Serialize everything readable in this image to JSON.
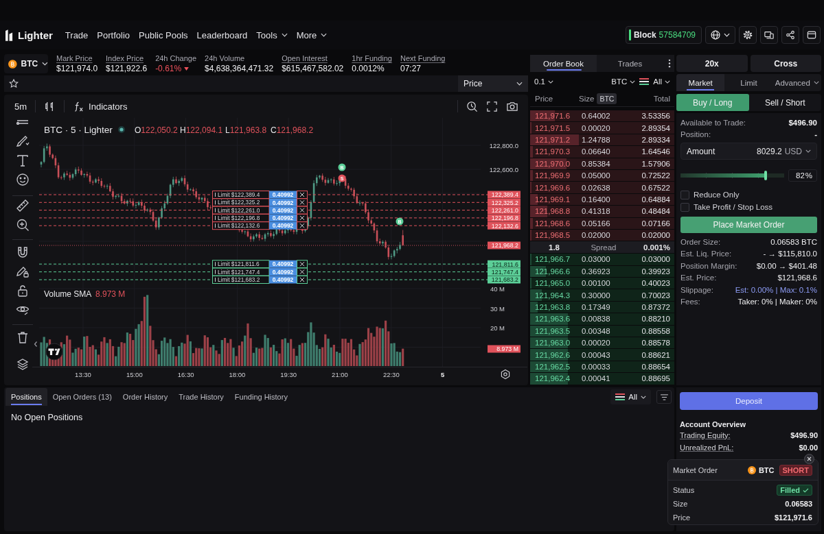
{
  "header": {
    "logo": "Lighter",
    "nav": [
      {
        "label": "Trade",
        "dropdown": false
      },
      {
        "label": "Portfolio",
        "dropdown": false
      },
      {
        "label": "Public Pools",
        "dropdown": false
      },
      {
        "label": "Leaderboard",
        "dropdown": false
      },
      {
        "label": "Tools",
        "dropdown": true
      },
      {
        "label": "More",
        "dropdown": true
      }
    ],
    "block": {
      "label": "Block",
      "value": "57584709"
    }
  },
  "ticker": {
    "symbol": "BTC",
    "stats": [
      {
        "label": "Mark Price",
        "value": "$121,974.0",
        "underlined": true,
        "negative": false
      },
      {
        "label": "Index Price",
        "value": "$121,922.6",
        "underlined": true,
        "negative": false
      },
      {
        "label": "24h Change",
        "value": "-0.61%",
        "underlined": false,
        "negative": true
      },
      {
        "label": "24h Volume",
        "value": "$4,638,364,471.32",
        "underlined": false,
        "negative": false
      },
      {
        "label": "Open Interest",
        "value": "$615,467,582.02",
        "underlined": true,
        "negative": false
      },
      {
        "label": "1hr Funding",
        "value": "0.0012%",
        "underlined": true,
        "negative": false
      },
      {
        "label": "Next Funding",
        "value": "07:27",
        "underlined": true,
        "negative": false
      }
    ]
  },
  "chart": {
    "price_type": "Price",
    "interval": "5m",
    "indicators": "Indicators",
    "title": "BTC · 5 · Lighter",
    "ohlc": [
      {
        "letter": "O",
        "value": "122,050.2"
      },
      {
        "letter": "H",
        "value": "122,094.1"
      },
      {
        "letter": "L",
        "value": "121,963.8"
      },
      {
        "letter": "C",
        "value": "121,968.2"
      }
    ],
    "price_ticks": [
      "122,800.0",
      "122,600.0"
    ],
    "orders": [
      {
        "kind": "sell",
        "label": "Limit $122,389.4",
        "size": "0.40992",
        "tag": "122,389.4"
      },
      {
        "kind": "sell",
        "label": "Limit $122,325.2",
        "size": "0.40992",
        "tag": "122,325.2"
      },
      {
        "kind": "sell",
        "label": "Limit $122,261.0",
        "size": "0.40992",
        "tag": "122,261.0"
      },
      {
        "kind": "sell",
        "label": "Limit $122,196.8",
        "size": "0.40992",
        "tag": "122,196.8"
      },
      {
        "kind": "sell",
        "label": "Limit $122,132.6",
        "size": "0.40992",
        "tag": "122,132.6"
      },
      {
        "kind": "buy",
        "label": "Limit $121,811.6",
        "size": "0.40992",
        "tag": "121,811.6"
      },
      {
        "kind": "buy",
        "label": "Limit $121,747.4",
        "size": "0.40992",
        "tag": "121,747.4"
      },
      {
        "kind": "buy",
        "label": "Limit $121,683.2",
        "size": "0.40992",
        "tag": "121,683.2"
      }
    ],
    "last_price": "121,968.2",
    "markers": [
      {
        "kind": "buy",
        "letter": "B"
      },
      {
        "kind": "sell",
        "letter": "S"
      },
      {
        "kind": "buy",
        "letter": "B"
      }
    ],
    "volume_label": "Volume SMA",
    "volume_value": "8.973 M",
    "volume_ticks": [
      "40 M",
      "30 M",
      "20 M"
    ],
    "volume_tag": "8.973 M",
    "time_ticks": [
      "13:30",
      "15:00",
      "16:30",
      "18:00",
      "19:30",
      "21:00",
      "22:30"
    ],
    "time_scale_label": "5"
  },
  "order_book": {
    "tabs": [
      {
        "label": "Order Book",
        "selected": true
      },
      {
        "label": "Trades",
        "selected": false
      }
    ],
    "tick_size": "0.1",
    "unit": "BTC",
    "filter": "All",
    "columns": [
      "Price",
      "Size",
      "Total"
    ],
    "size_badge": "BTC",
    "asks": [
      {
        "price": "121,971.6",
        "size": "0.64002",
        "total": "3.53356",
        "level": 0.17
      },
      {
        "price": "121,971.5",
        "size": "0.00020",
        "total": "2.89354",
        "level": 0.01
      },
      {
        "price": "121,971.2",
        "size": "1.24788",
        "total": "2.89334",
        "level": 0.34
      },
      {
        "price": "121,970.3",
        "size": "0.06640",
        "total": "1.64546",
        "level": 0.02
      },
      {
        "price": "121,970.0",
        "size": "0.85384",
        "total": "1.57906",
        "level": 0.25
      },
      {
        "price": "121,969.9",
        "size": "0.05000",
        "total": "0.72522",
        "level": 0.02
      },
      {
        "price": "121,969.6",
        "size": "0.02638",
        "total": "0.67522",
        "level": 0.01
      },
      {
        "price": "121,969.1",
        "size": "0.16400",
        "total": "0.64884",
        "level": 0.05
      },
      {
        "price": "121,968.8",
        "size": "0.41318",
        "total": "0.48484",
        "level": 0.12
      },
      {
        "price": "121,968.6",
        "size": "0.05166",
        "total": "0.07166",
        "level": 0.02
      },
      {
        "price": "121,968.5",
        "size": "0.02000",
        "total": "0.02000",
        "level": 0.01
      }
    ],
    "spread": {
      "value": "1.8",
      "label": "Spread",
      "percent": "0.001%"
    },
    "bids": [
      {
        "price": "121,966.7",
        "size": "0.03000",
        "total": "0.03000",
        "level": 0.01
      },
      {
        "price": "121,966.6",
        "size": "0.36923",
        "total": "0.39923",
        "level": 0.11
      },
      {
        "price": "121,965.0",
        "size": "0.00100",
        "total": "0.40023",
        "level": 0.01
      },
      {
        "price": "121,964.3",
        "size": "0.30000",
        "total": "0.70023",
        "level": 0.08
      },
      {
        "price": "121,963.8",
        "size": "0.17349",
        "total": "0.87372",
        "level": 0.05
      },
      {
        "price": "121,963.6",
        "size": "0.00838",
        "total": "0.88210",
        "level": 0.26
      },
      {
        "price": "121,963.5",
        "size": "0.00348",
        "total": "0.88558",
        "level": 0.26
      },
      {
        "price": "121,963.0",
        "size": "0.00020",
        "total": "0.88578",
        "level": 0.26
      },
      {
        "price": "121,962.6",
        "size": "0.00043",
        "total": "0.88621",
        "level": 0.26
      },
      {
        "price": "121,962.5",
        "size": "0.00033",
        "total": "0.88654",
        "level": 0.26
      },
      {
        "price": "121,962.4",
        "size": "0.00041",
        "total": "0.88695",
        "level": 0.26
      }
    ]
  },
  "order_form": {
    "leverage": "20x",
    "margin_mode": "Cross",
    "type_tabs": [
      {
        "label": "Market",
        "selected": true,
        "dropdown": false
      },
      {
        "label": "Limit",
        "selected": false,
        "dropdown": false
      },
      {
        "label": "Advanced",
        "selected": false,
        "dropdown": true
      }
    ],
    "sides": [
      {
        "label": "Buy / Long",
        "selected": true,
        "kind": "buy"
      },
      {
        "label": "Sell / Short",
        "selected": false,
        "kind": "sell"
      }
    ],
    "info": [
      {
        "label": "Available to Trade:",
        "value": "$496.90"
      },
      {
        "label": "Position:",
        "value": "-"
      }
    ],
    "amount": {
      "label": "Amount",
      "value": "8029.2",
      "unit": "USD"
    },
    "slider": {
      "level": 0.82,
      "value": "82",
      "unit": "%"
    },
    "checkboxes": [
      {
        "label": "Reduce Only",
        "checked": false
      },
      {
        "label": "Take Profit / Stop Loss",
        "checked": false
      }
    ],
    "submit": "Place Market Order",
    "summary": [
      {
        "label": "Order Size:",
        "value": "0.06583 BTC",
        "accent": false
      },
      {
        "label": "Est. Liq. Price:",
        "value": "- → $115,810.0",
        "accent": false
      },
      {
        "label": "Position Margin:",
        "value": "$0.00 → $401.48",
        "accent": false
      },
      {
        "label": "Est. Price:",
        "value": "$121,968.6",
        "accent": false
      },
      {
        "label": "Slippage:",
        "value": "Est: 0.00% | Max: 0.1%",
        "accent": true
      },
      {
        "label": "Fees:",
        "value": "Taker: 0% | Maker: 0%",
        "accent": false
      }
    ]
  },
  "positions": {
    "tabs": [
      {
        "label": "Positions",
        "selected": true
      },
      {
        "label": "Open Orders (13)",
        "selected": false
      },
      {
        "label": "Order History",
        "selected": false
      },
      {
        "label": "Trade History",
        "selected": false
      },
      {
        "label": "Funding History",
        "selected": false
      }
    ],
    "filter": "All",
    "empty_message": "No Open Positions"
  },
  "account": {
    "deposit": "Deposit",
    "title": "Account Overview",
    "rows": [
      {
        "label": "Trading Equity:",
        "value": "$496.90"
      },
      {
        "label": "Unrealized PnL:",
        "value": "$0.00"
      }
    ]
  },
  "toast": {
    "title": "Market Order",
    "symbol": "BTC",
    "side": {
      "label": "SHORT",
      "kind": "sell"
    },
    "rows": [
      {
        "label": "Status",
        "value": "Filled",
        "kind": "status"
      },
      {
        "label": "Size",
        "value": "0.06583",
        "kind": "text"
      },
      {
        "label": "Price",
        "value": "$121,971.6",
        "kind": "text"
      }
    ]
  }
}
